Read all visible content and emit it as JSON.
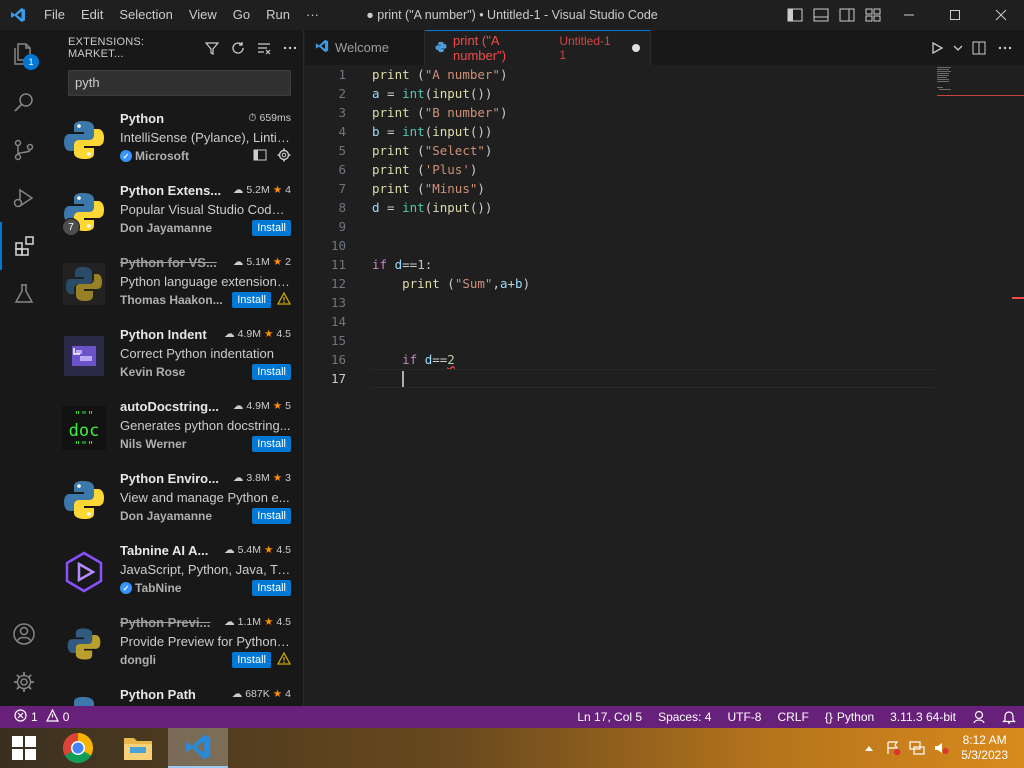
{
  "window": {
    "title": "● print (\"A number\") • Untitled-1 - Visual Studio Code",
    "menu": [
      "File",
      "Edit",
      "Selection",
      "View",
      "Go",
      "Run",
      "···"
    ]
  },
  "activity_bar": {
    "explorer_badge": "1",
    "items": [
      "explorer-icon",
      "search-icon",
      "source-control-icon",
      "run-debug-icon",
      "extensions-icon",
      "testing-icon"
    ],
    "bottom": [
      "accounts-icon",
      "settings-gear-icon"
    ]
  },
  "sidebar": {
    "title": "EXTENSIONS: MARKET...",
    "search_value": "pyth",
    "extensions": [
      {
        "name": "Python",
        "stats": "659ms",
        "desc": "IntelliSense (Pylance), Lintin...",
        "publisher": "Microsoft",
        "verified": true,
        "installed": true
      },
      {
        "name": "Python Extens...",
        "downloads": "5.2M",
        "rating": "4",
        "desc": "Popular Visual Studio Code ...",
        "publisher": "Don Jayamanne",
        "install": "Install",
        "pack_count": "7"
      },
      {
        "name": "Python for VS...",
        "downloads": "5.1M",
        "rating": "2",
        "desc": "Python language extension f...",
        "publisher": "Thomas Haakon...",
        "install": "Install",
        "deprecated": true
      },
      {
        "name": "Python Indent",
        "downloads": "4.9M",
        "rating": "4.5",
        "desc": "Correct Python indentation",
        "publisher": "Kevin Rose",
        "install": "Install"
      },
      {
        "name": "autoDocstring...",
        "downloads": "4.9M",
        "rating": "5",
        "desc": "Generates python docstring...",
        "publisher": "Nils Werner",
        "install": "Install",
        "icon_text": "doc",
        "icon_quotes": "\"\"\""
      },
      {
        "name": "Python Enviro...",
        "downloads": "3.8M",
        "rating": "3",
        "desc": "View and manage Python e...",
        "publisher": "Don Jayamanne",
        "install": "Install"
      },
      {
        "name": "Tabnine AI A...",
        "downloads": "5.4M",
        "rating": "4.5",
        "desc": "JavaScript, Python, Java, Typ...",
        "publisher": "TabNine",
        "verified": true,
        "install": "Install"
      },
      {
        "name": "Python Previ...",
        "downloads": "1.1M",
        "rating": "4.5",
        "desc": "Provide Preview for Python ...",
        "publisher": "dongli",
        "install": "Install",
        "deprecated": true
      },
      {
        "name": "Python Path",
        "downloads": "687K",
        "rating": "4"
      }
    ]
  },
  "tabs": {
    "welcome": "Welcome",
    "active_title": "print (\"A number\")",
    "active_sub": "Untitled-1",
    "active_problems": "1"
  },
  "editor": {
    "line_numbers": [
      "1",
      "2",
      "3",
      "4",
      "5",
      "6",
      "7",
      "8",
      "9",
      "10",
      "11",
      "12",
      "13",
      "14",
      "15",
      "16",
      "17"
    ],
    "current_line": 17
  },
  "status": {
    "errors": "1",
    "warnings": "0",
    "position": "Ln 17, Col 5",
    "spaces": "Spaces: 4",
    "encoding": "UTF-8",
    "eol": "CRLF",
    "language": "Python",
    "interpreter": "3.11.3 64-bit"
  },
  "taskbar": {
    "time": "8:12 AM",
    "date": "5/3/2023"
  },
  "colors": {
    "status_bar": "#68217a",
    "accent": "#0078d4",
    "error": "#f14c4c",
    "star": "#ff8e00"
  }
}
